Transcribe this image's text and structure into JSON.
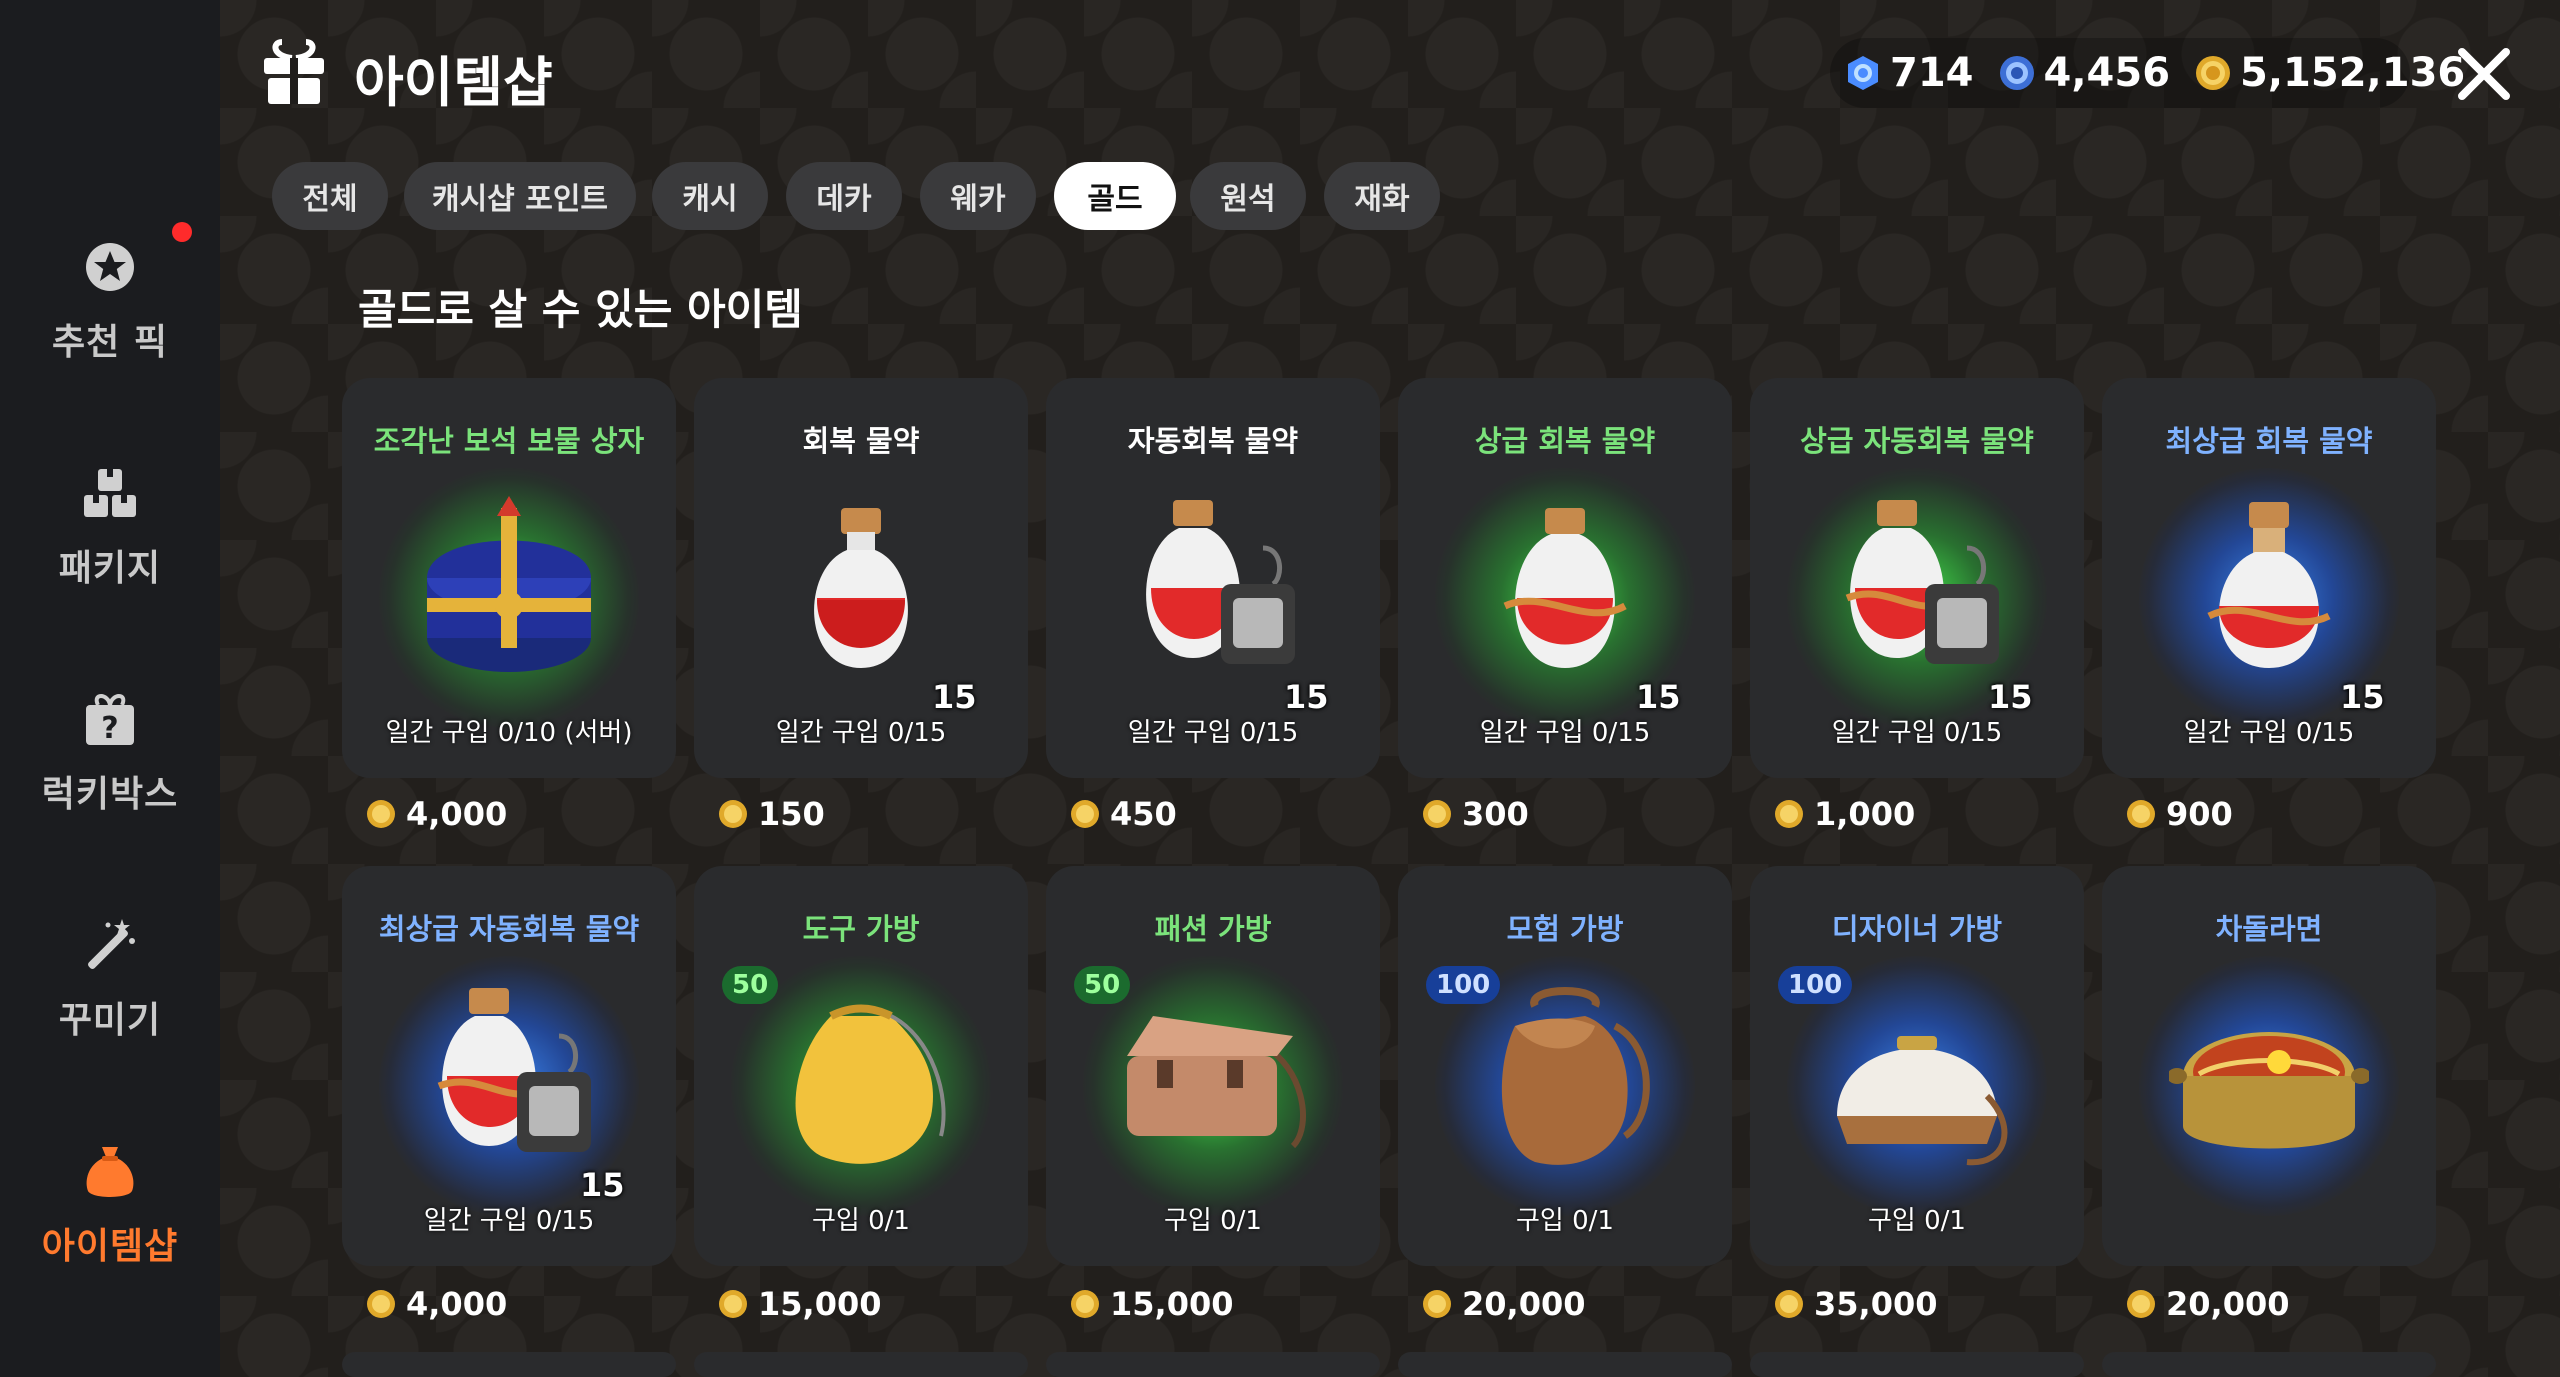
{
  "header": {
    "title": "아이템샵",
    "currencies": [
      {
        "icon": "blue-gem-icon",
        "value": "714"
      },
      {
        "icon": "blue-coin-icon",
        "value": "4,456"
      },
      {
        "icon": "gold-coin-icon",
        "value": "5,152,136"
      }
    ]
  },
  "sidebar": {
    "items": [
      {
        "label": "추천 픽",
        "icon": "star-badge-icon"
      },
      {
        "label": "패키지",
        "icon": "boxes-icon"
      },
      {
        "label": "럭키박스",
        "icon": "mystery-box-icon"
      },
      {
        "label": "꾸미기",
        "icon": "magic-wand-icon"
      },
      {
        "label": "아이템샵",
        "icon": "bag-icon"
      }
    ],
    "active_index": 4
  },
  "tabs": [
    "전체",
    "캐시샵 포인트",
    "캐시",
    "데카",
    "웨카",
    "골드",
    "원석",
    "재화"
  ],
  "active_tab": "골드",
  "section_title": "골드로 살 수 있는 아이템",
  "items": [
    {
      "name": "조각난 보석 보물 상자",
      "tier": "green",
      "qty": "",
      "limit": "일간 구입 0/10 (서버)",
      "badge": "",
      "price": "4,000",
      "icon": "treasure-chest-icon"
    },
    {
      "name": "회복 물약",
      "tier": "white",
      "qty": "15",
      "limit": "일간 구입 0/15",
      "badge": "",
      "price": "150",
      "icon": "red-potion-icon"
    },
    {
      "name": "자동회복 물약",
      "tier": "white",
      "qty": "15",
      "limit": "일간 구입 0/15",
      "badge": "",
      "price": "450",
      "icon": "auto-potion-icon"
    },
    {
      "name": "상급 회복 물약",
      "tier": "green",
      "qty": "15",
      "limit": "일간 구입 0/15",
      "badge": "",
      "price": "300",
      "icon": "red-potion-icon"
    },
    {
      "name": "상급 자동회복 물약",
      "tier": "green",
      "qty": "15",
      "limit": "일간 구입 0/15",
      "badge": "",
      "price": "1,000",
      "icon": "auto-potion-icon"
    },
    {
      "name": "최상급 회복 물약",
      "tier": "blue",
      "qty": "15",
      "limit": "일간 구입 0/15",
      "badge": "",
      "price": "900",
      "icon": "red-potion-icon"
    },
    {
      "name": "최상급 자동회복 물약",
      "tier": "blue",
      "qty": "15",
      "limit": "일간 구입 0/15",
      "badge": "",
      "price": "4,000",
      "icon": "auto-potion-icon"
    },
    {
      "name": "도구 가방",
      "tier": "green",
      "qty": "",
      "limit": "구입 0/1",
      "badge": "50",
      "price": "15,000",
      "icon": "drawstring-bag-icon"
    },
    {
      "name": "패션 가방",
      "tier": "green",
      "qty": "",
      "limit": "구입 0/1",
      "badge": "50",
      "price": "15,000",
      "icon": "satchel-icon"
    },
    {
      "name": "모험 가방",
      "tier": "blue",
      "qty": "",
      "limit": "구입 0/1",
      "badge": "100",
      "price": "20,000",
      "icon": "backpack-icon"
    },
    {
      "name": "디자이너 가방",
      "tier": "blue",
      "qty": "",
      "limit": "구입 0/1",
      "badge": "100",
      "price": "35,000",
      "icon": "designer-bag-icon"
    },
    {
      "name": "차돌라면",
      "tier": "blue",
      "qty": "",
      "limit": "",
      "badge": "",
      "price": "20,000",
      "icon": "ramen-pot-icon"
    }
  ]
}
